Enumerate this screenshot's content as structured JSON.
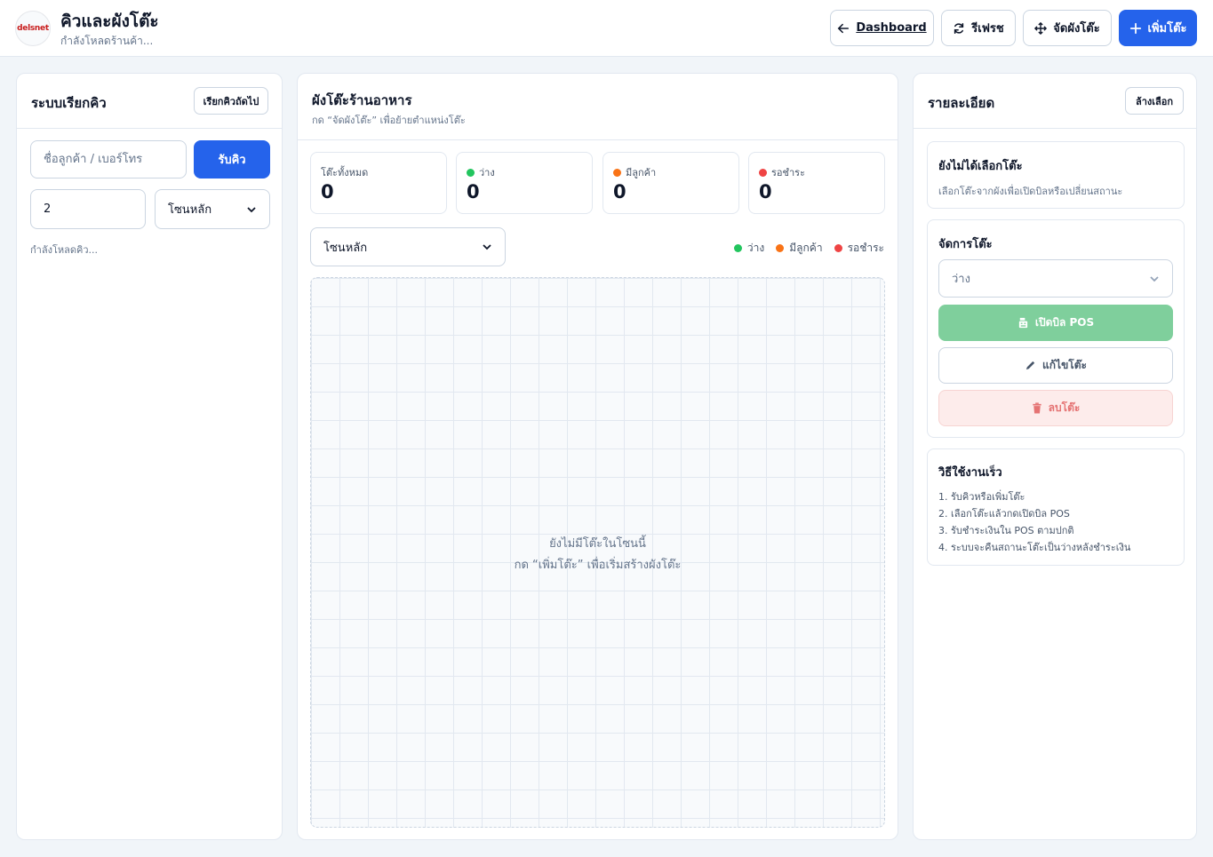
{
  "header": {
    "logo_text": "delsnet",
    "title": "คิวและผังโต๊ะ",
    "subtitle": "กำลังโหลดร้านค้า...",
    "buttons": {
      "dashboard": "Dashboard",
      "refresh": "รีเฟรช",
      "arrange": "จัดผังโต๊ะ",
      "add_table": "เพิ่มโต๊ะ"
    }
  },
  "queue": {
    "title": "ระบบเรียกคิว",
    "call_next": "เรียกคิวถัดไป",
    "name_placeholder": "ชื่อลูกค้า / เบอร์โทร",
    "get_queue": "รับคิว",
    "party_size": "2",
    "zone_selected": "โซนหลัก",
    "status": "กำลังโหลดคิว..."
  },
  "floor": {
    "title": "ผังโต๊ะร้านอาหาร",
    "hint": "กด “จัดผังโต๊ะ” เพื่อย้ายตำแหน่งโต๊ะ",
    "stats": [
      {
        "label": "โต๊ะทั้งหมด",
        "value": "0",
        "color": ""
      },
      {
        "label": "ว่าง",
        "value": "0",
        "color": "#22c55e"
      },
      {
        "label": "มีลูกค้า",
        "value": "0",
        "color": "#f97316"
      },
      {
        "label": "รอชำระ",
        "value": "0",
        "color": "#ef4444"
      }
    ],
    "zone_selected": "โซนหลัก",
    "legend": [
      {
        "label": "ว่าง",
        "color": "#22c55e"
      },
      {
        "label": "มีลูกค้า",
        "color": "#f97316"
      },
      {
        "label": "รอชำระ",
        "color": "#ef4444"
      }
    ],
    "empty_line1": "ยังไม่มีโต๊ะในโซนนี้",
    "empty_line2": "กด “เพิ่มโต๊ะ” เพื่อเริ่มสร้างผังโต๊ะ"
  },
  "details": {
    "title": "รายละเอียด",
    "clear": "ล้างเลือก",
    "none_title": "ยังไม่ได้เลือกโต๊ะ",
    "none_desc": "เลือกโต๊ะจากผังเพื่อเปิดบิลหรือเปลี่ยนสถานะ",
    "manage_title": "จัดการโต๊ะ",
    "status_selected": "ว่าง",
    "open_pos": "เปิดบิล POS",
    "edit": "แก้ไขโต๊ะ",
    "delete": "ลบโต๊ะ",
    "howto_title": "วิธีใช้งานเร็ว",
    "steps": [
      "1. รับคิวหรือเพิ่มโต๊ะ",
      "2. เลือกโต๊ะแล้วกดเปิดบิล POS",
      "3. รับชำระเงินใน POS ตามปกติ",
      "4. ระบบจะคืนสถานะโต๊ะเป็นว่างหลังชำระเงิน"
    ]
  }
}
